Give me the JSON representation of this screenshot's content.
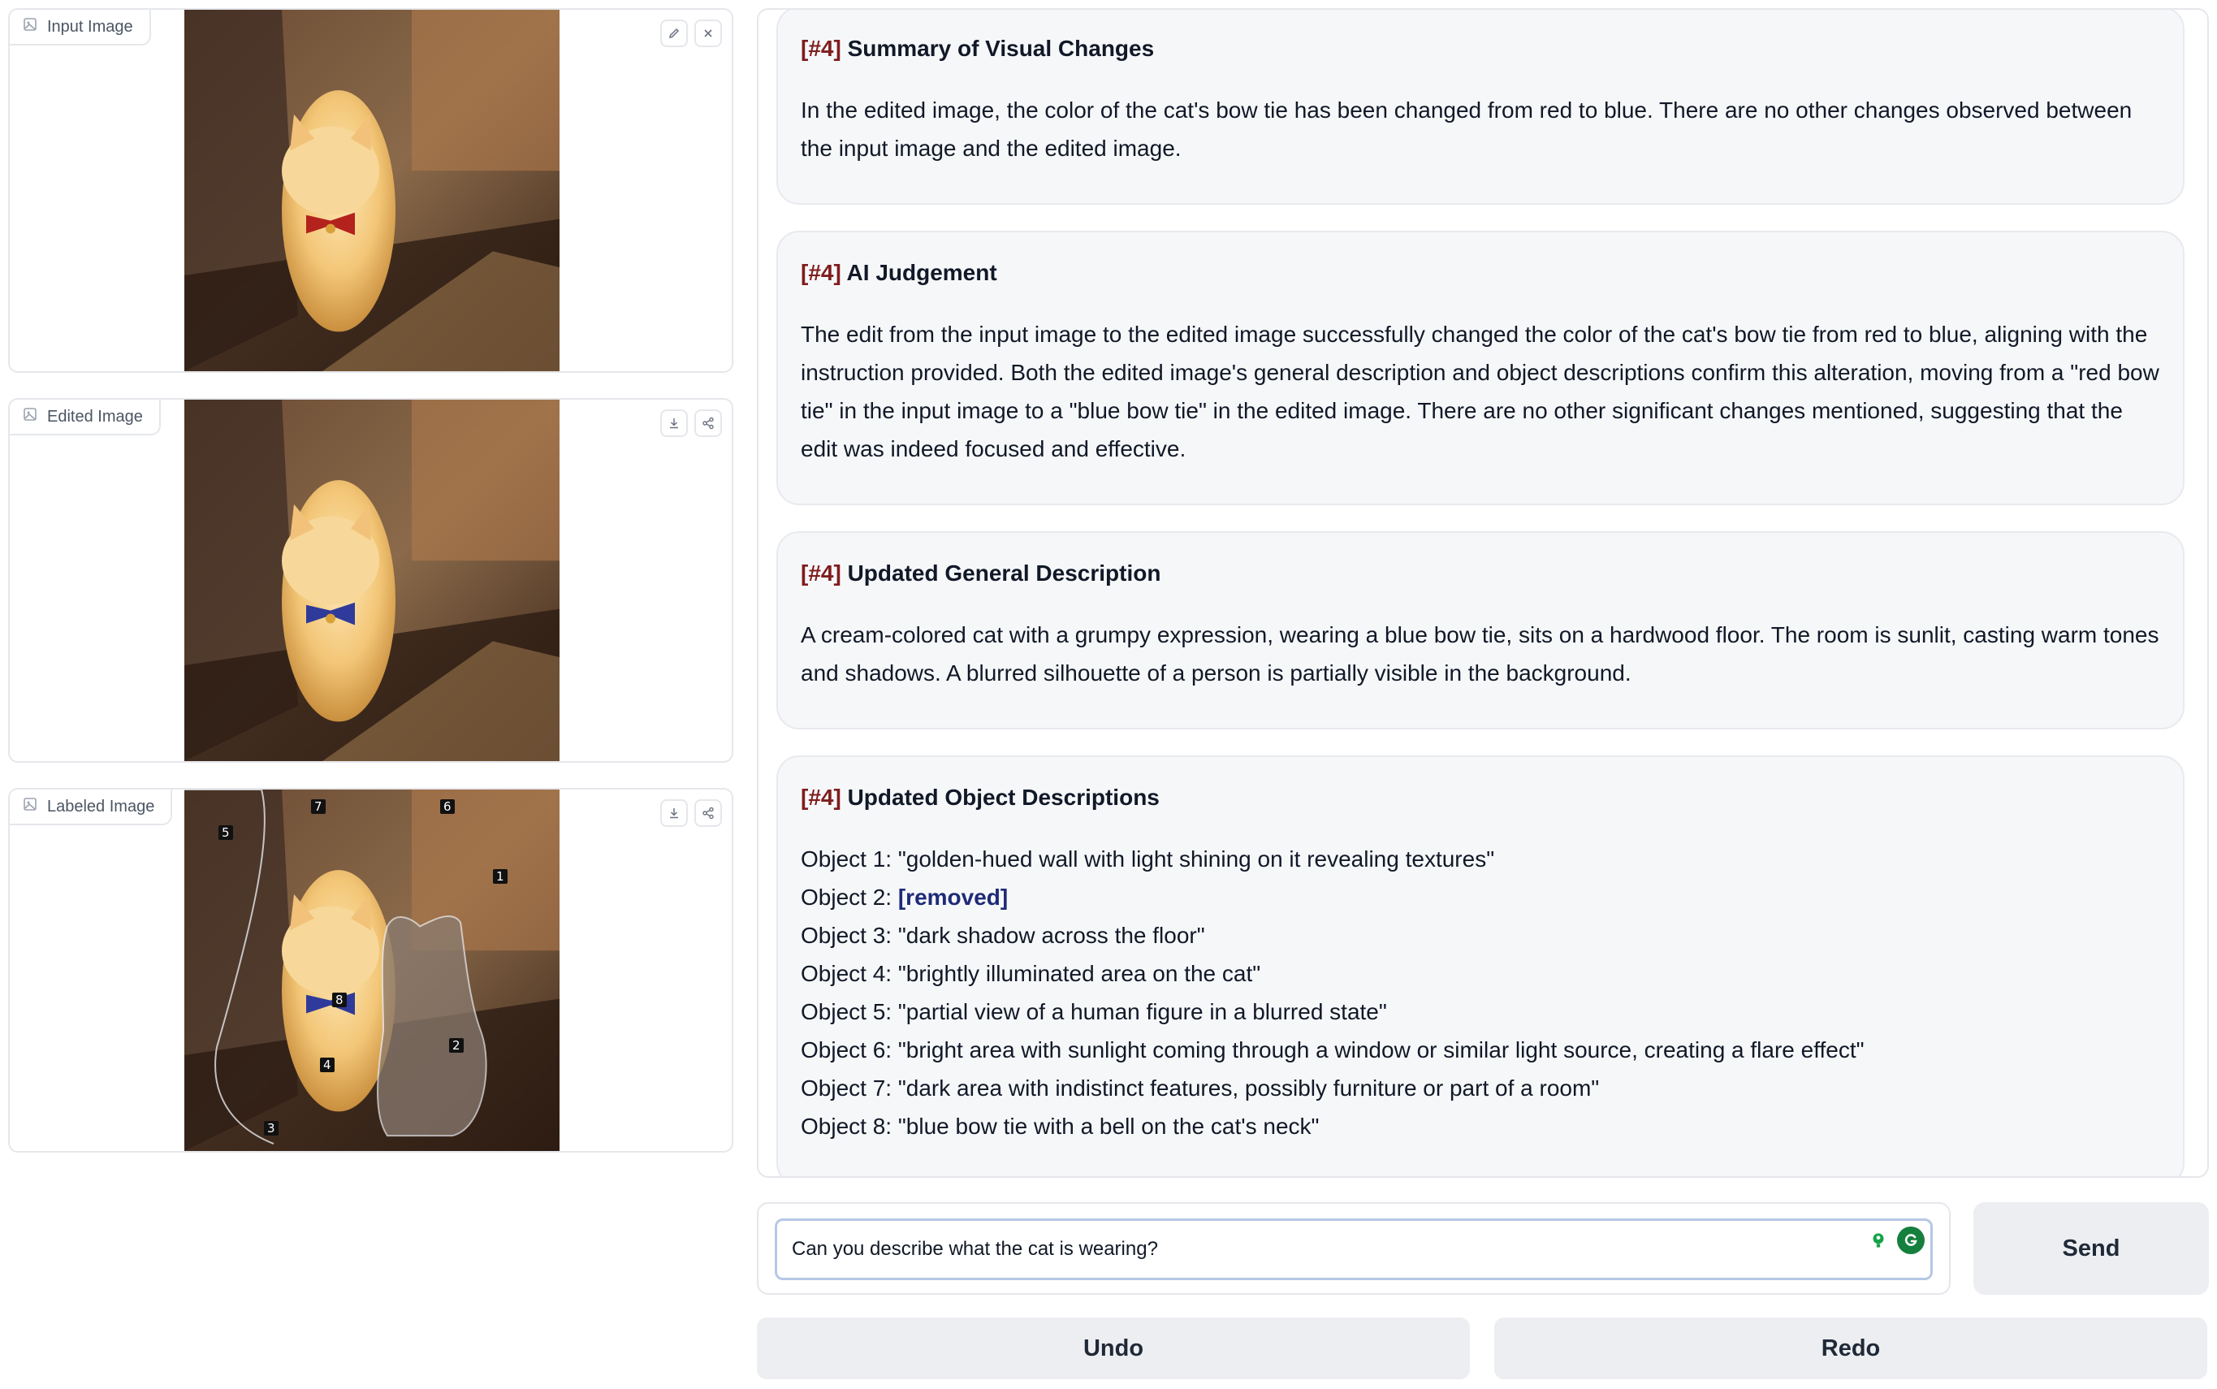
{
  "panels": {
    "input": {
      "label": "Input Image",
      "tools": [
        "edit-icon",
        "close-icon"
      ]
    },
    "edited": {
      "label": "Edited Image",
      "tools": [
        "download-icon",
        "share-icon"
      ]
    },
    "labeled": {
      "label": "Labeled Image",
      "tools": [
        "download-icon",
        "share-icon"
      ],
      "segment_labels": [
        "1",
        "2",
        "3",
        "4",
        "5",
        "6",
        "7",
        "8"
      ]
    }
  },
  "chat": {
    "messages": [
      {
        "tag": "[#4]",
        "title": "Summary of Visual Changes",
        "body": "In the edited image, the color of the cat's bow tie has been changed from red to blue. There are no other changes observed between the input image and the edited image."
      },
      {
        "tag": "[#4]",
        "title": "AI Judgement",
        "body": "The edit from the input image to the edited image successfully changed the color of the cat's bow tie from red to blue, aligning with the instruction provided. Both the edited image's general description and object descriptions confirm this alteration, moving from a \"red bow tie\" in the input image to a \"blue bow tie\" in the edited image. There are no other significant changes mentioned, suggesting that the edit was indeed focused and effective."
      },
      {
        "tag": "[#4]",
        "title": "Updated General Description",
        "body": "A cream-colored cat with a grumpy expression, wearing a blue bow tie, sits on a hardwood floor. The room is sunlit, casting warm tones and shadows. A blurred silhouette of a person is partially visible in the background."
      },
      {
        "tag": "[#4]",
        "title": "Updated Object Descriptions",
        "objects": [
          {
            "prefix": "Object 1:",
            "text": "\"golden-hued wall with light shining on it revealing textures\""
          },
          {
            "prefix": "Object 2:",
            "text": "[removed]"
          },
          {
            "prefix": "Object 3:",
            "text": "\"dark shadow across the floor\""
          },
          {
            "prefix": "Object 4:",
            "text": "\"brightly illuminated area on the cat\""
          },
          {
            "prefix": "Object 5:",
            "text": "\"partial view of a human figure in a blurred state\""
          },
          {
            "prefix": "Object 6:",
            "text": "\"bright area with sunlight coming through a window or similar light source, creating a flare effect\""
          },
          {
            "prefix": "Object 7:",
            "text": "\"dark area with indistinct features, possibly furniture or part of a room\""
          },
          {
            "prefix": "Object 8:",
            "text": "\"blue bow tie with a bell on the cat's neck\""
          }
        ]
      }
    ]
  },
  "composer": {
    "value": "Can you describe what the cat is wearing?",
    "send_label": "Send",
    "icons": [
      "lightbulb-icon",
      "grammarly-icon"
    ]
  },
  "actions": {
    "undo_label": "Undo",
    "redo_label": "Redo"
  },
  "colors": {
    "tag_red": "#7f1d1d",
    "removed_blue": "#1e2a78",
    "bubble_bg": "#f6f7f9",
    "button_bg": "#eceef1"
  }
}
